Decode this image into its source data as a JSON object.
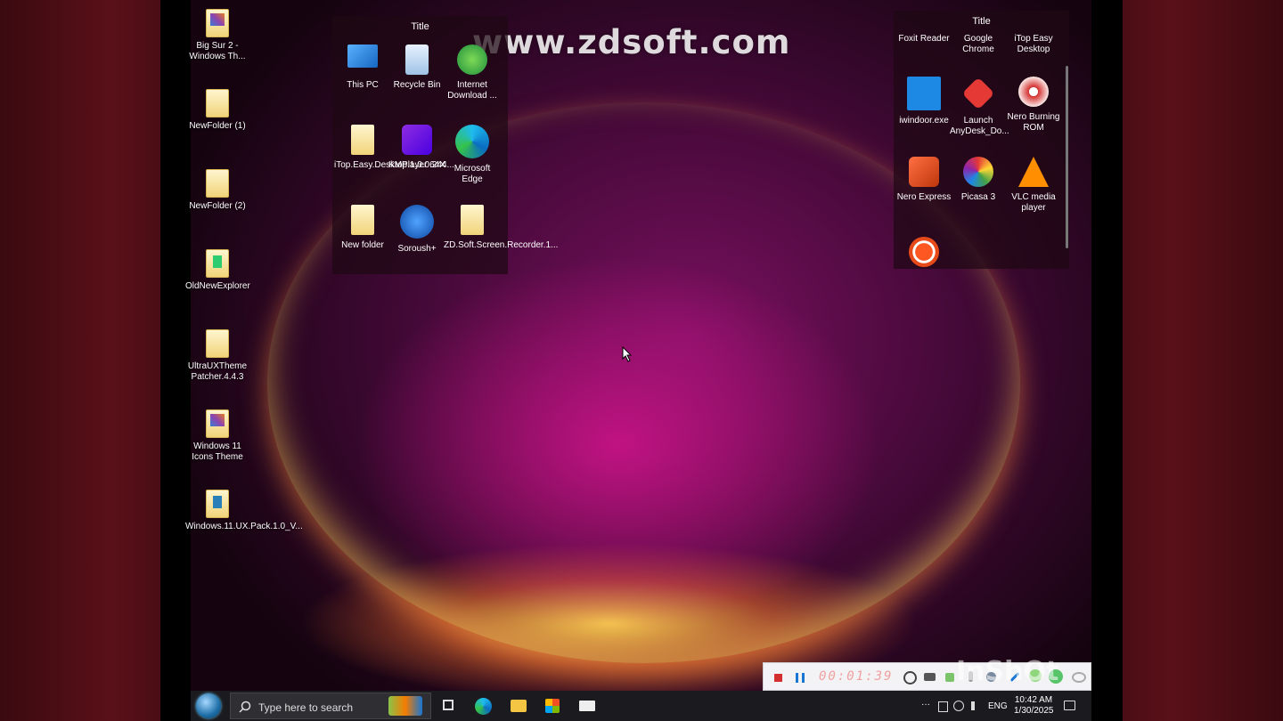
{
  "watermark": "www.zdsoft.com",
  "desktop_icons": [
    {
      "label": "Big Sur 2 - Windows Th..."
    },
    {
      "label": "NewFolder (1)"
    },
    {
      "label": "NewFolder (2)"
    },
    {
      "label": "OldNewExplorer"
    },
    {
      "label": "UltraUXTheme Patcher.4.4.3"
    },
    {
      "label": "Windows 11 Icons Theme"
    },
    {
      "label": "Windows.11.UX.Pack.1.0_V..."
    }
  ],
  "fence_left": {
    "title": "Title",
    "items": [
      {
        "label": "This PC"
      },
      {
        "label": "Recycle Bin"
      },
      {
        "label": "Internet Download ..."
      },
      {
        "label": "iTop.Easy.Desktop.1.0.0.244..."
      },
      {
        "label": "KMPlayer 64X"
      },
      {
        "label": "Microsoft Edge"
      },
      {
        "label": "New folder"
      },
      {
        "label": "Soroush+"
      },
      {
        "label": "ZD.Soft.Screen.Recorder.1..."
      }
    ]
  },
  "fence_right": {
    "title": "Title",
    "items": [
      {
        "label": "Foxit Reader"
      },
      {
        "label": "Google Chrome"
      },
      {
        "label": "iTop Easy Desktop"
      },
      {
        "label": "iwindoor.exe"
      },
      {
        "label": "Launch AnyDesk_Do..."
      },
      {
        "label": "Nero Burning ROM"
      },
      {
        "label": "Nero Express"
      },
      {
        "label": "Picasa 3"
      },
      {
        "label": "VLC media player"
      },
      {
        "label": ""
      }
    ]
  },
  "recorder": {
    "timer": "00:01:39",
    "overlay": "InShOt"
  },
  "taskbar": {
    "search_placeholder": "Type here to search",
    "language": "ENG",
    "time": "10:42 AM",
    "date": "1/30/2025"
  }
}
